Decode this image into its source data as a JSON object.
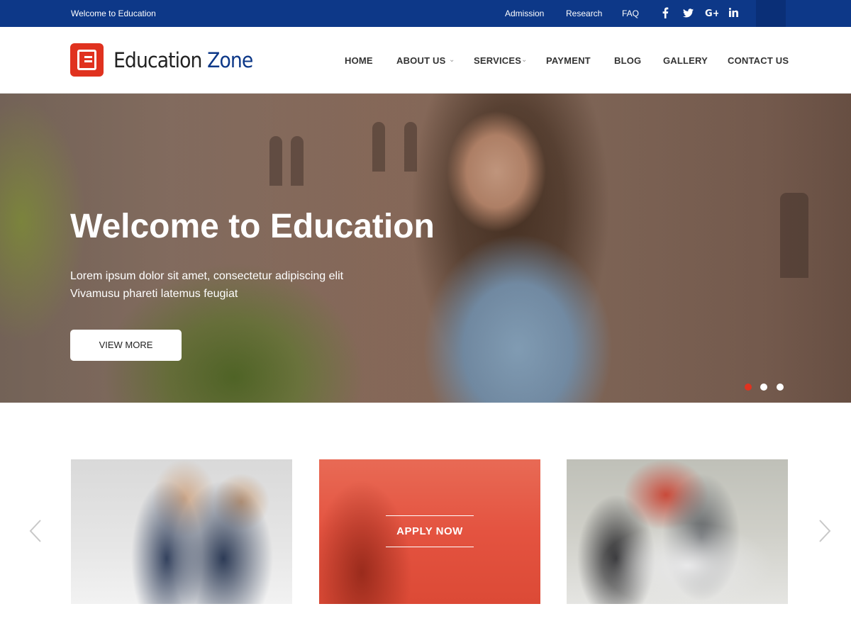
{
  "topbar": {
    "welcome": "Welcome to Education",
    "links": [
      "Admission",
      "Research",
      "FAQ"
    ],
    "social_icons": [
      "facebook-icon",
      "twitter-icon",
      "google-plus-icon",
      "linkedin-icon"
    ]
  },
  "header": {
    "logo_text_main": "Education",
    "logo_text_accent": "Zone",
    "nav": [
      "HOME",
      "ABOUT US",
      "SERVICES",
      "PAYMENT",
      "BLOG",
      "GALLERY",
      "CONTACT US"
    ]
  },
  "hero": {
    "title": "Welcome to Education",
    "subtitle_line1": "Lorem ipsum dolor sit amet, consectetur adipiscing elit",
    "subtitle_line2": "Vivamusu phareti latemus feugiat",
    "button_label": "VIEW MORE",
    "slide_count": 3,
    "active_slide": 1
  },
  "cards": {
    "apply_label": "APPLY NOW"
  },
  "colors": {
    "brand_blue": "#0d3888",
    "accent_red": "#e0321f"
  }
}
